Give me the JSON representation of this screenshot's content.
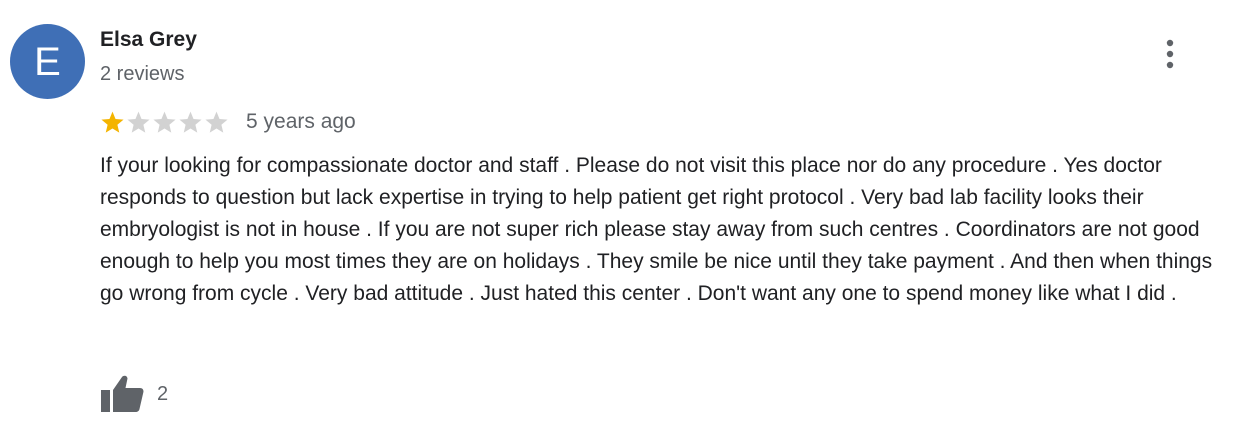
{
  "review": {
    "avatar_letter": "E",
    "author": "Elsa Grey",
    "review_count": "2 reviews",
    "rating": 1,
    "max_rating": 5,
    "time_ago": "5 years ago",
    "text": "If your looking for compassionate doctor and staff . Please do not visit this place nor do any procedure . Yes doctor responds to question but lack expertise in trying to help patient get right protocol . Very bad lab facility looks their embryologist is not in house . If you are not super rich please stay away from such centres . Coordinators are not good enough to help you most times they are on holidays . They smile be nice until they take payment . And then when things go wrong from cycle . Very bad attitude . Just hated this center . Don't want any one to spend money like what I did .",
    "like_count": "2"
  },
  "icons": {
    "more": "more-vert-icon",
    "star": "star-icon",
    "like": "thumb-up-icon"
  },
  "colors": {
    "avatar_bg": "#3f6fb6",
    "star_filled": "#f4b400",
    "star_empty": "#d2d2d2",
    "icon_gray": "#5f6368"
  }
}
